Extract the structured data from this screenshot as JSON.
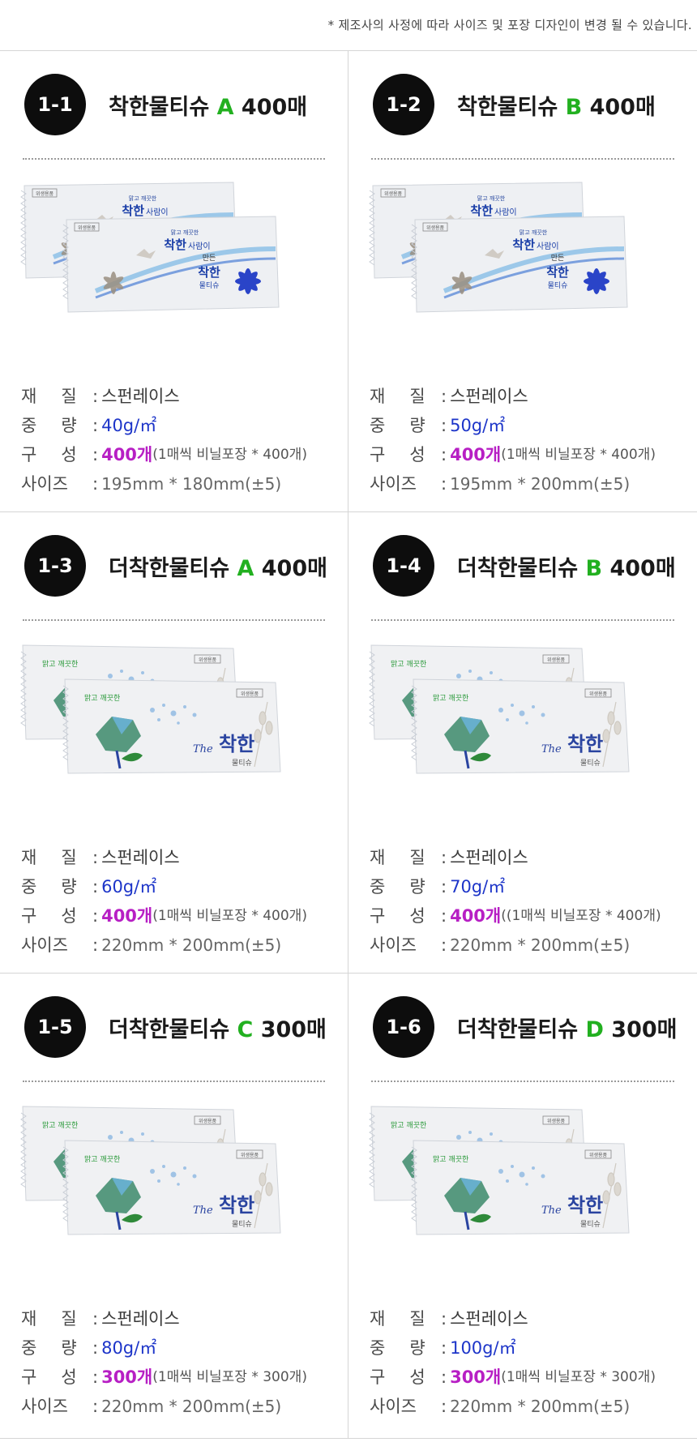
{
  "notice": "* 제조사의 사정에 따라 사이즈 및 포장 디자인이 변경 될 수 있습니다.",
  "labels": {
    "material_a": "재",
    "material_b": "질",
    "weight_a": "중",
    "weight_b": "량",
    "compose_a": "구",
    "compose_b": "성",
    "size": "사이즈",
    "colon": ":"
  },
  "colors": {
    "badge": "#0d0d0d",
    "grade": "#22b020",
    "weight": "#1d35c9",
    "count": "#b71fc4"
  },
  "products": [
    {
      "num": "1-1",
      "name": "착한물티슈",
      "grade": "A",
      "sheets": "400매",
      "design": "a",
      "material": "스펀레이스",
      "weight": "40g/㎡",
      "count": "400개",
      "pack": "(1매씩 비닐포장 * 400개)",
      "size": "195mm * 180mm(±5)"
    },
    {
      "num": "1-2",
      "name": "착한물티슈",
      "grade": "B",
      "sheets": "400매",
      "design": "a",
      "material": "스펀레이스",
      "weight": "50g/㎡",
      "count": "400개",
      "pack": "(1매씩 비닐포장 * 400개)",
      "size": "195mm * 200mm(±5)"
    },
    {
      "num": "1-3",
      "name": "더착한물티슈",
      "grade": "A",
      "sheets": "400매",
      "design": "b",
      "material": "스펀레이스",
      "weight": "60g/㎡",
      "count": "400개",
      "pack": "(1매씩 비닐포장 * 400개)",
      "size": "220mm * 200mm(±5)"
    },
    {
      "num": "1-4",
      "name": "더착한물티슈",
      "grade": "B",
      "sheets": "400매",
      "design": "b",
      "material": "스펀레이스",
      "weight": "70g/㎡",
      "count": "400개",
      "pack": "((1매씩 비닐포장 * 400개)",
      "size": "220mm * 200mm(±5)"
    },
    {
      "num": "1-5",
      "name": "더착한물티슈",
      "grade": "C",
      "sheets": "300매",
      "design": "b",
      "material": "스펀레이스",
      "weight": "80g/㎡",
      "count": "300개",
      "pack": "(1매씩 비닐포장 * 300개)",
      "size": "220mm * 200mm(±5)"
    },
    {
      "num": "1-6",
      "name": "더착한물티슈",
      "grade": "D",
      "sheets": "300매",
      "design": "b",
      "material": "스펀레이스",
      "weight": "100g/㎡",
      "count": "300개",
      "pack": "(1매씩 비닐포장 * 300개)",
      "size": "220mm * 200mm(±5)"
    }
  ],
  "packaging": {
    "a": {
      "hygiene": "위생용품",
      "tagline": "맑고 깨끗한",
      "brand": "착한",
      "brand_rest": "사람이",
      "made": "만든",
      "product": "착한",
      "product_sub": "물티슈"
    },
    "b": {
      "hygiene": "위생용품",
      "tagline": "맑고 깨끗한",
      "the": "The",
      "brand": "착한",
      "product_sub": "물티슈"
    }
  }
}
